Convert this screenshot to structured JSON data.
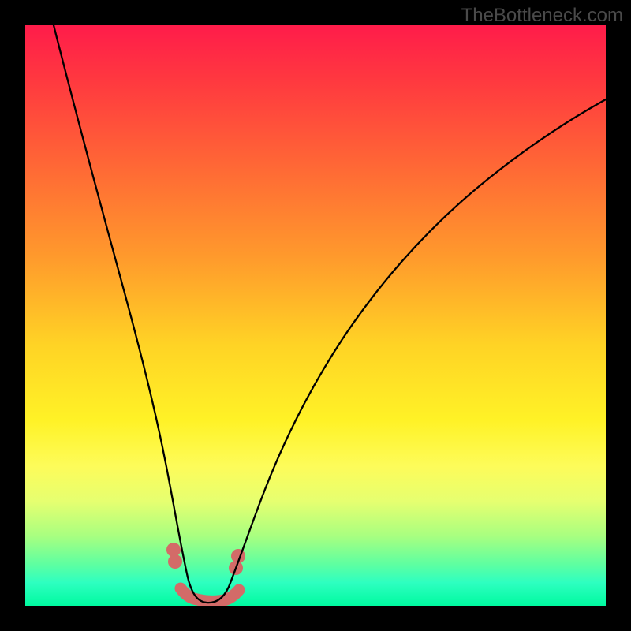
{
  "watermark": "TheBottleneck.com",
  "colors": {
    "frame": "#000000",
    "curve": "#000000",
    "valley_accent": "#d36b68",
    "gradient_top": "#ff1c4a",
    "gradient_bottom": "#00faa0"
  },
  "chart_data": {
    "type": "line",
    "title": "",
    "xlabel": "",
    "ylabel": "",
    "xlim": [
      0,
      100
    ],
    "ylim": [
      0,
      100
    ],
    "grid": false,
    "legend": false,
    "background": "vertical-gradient red→yellow→green",
    "series": [
      {
        "name": "bottleneck-curve",
        "note": "estimated from visual position; V-shaped curve with rounded valley near x≈31, y≈0",
        "x": [
          0,
          4,
          8,
          12,
          16,
          20,
          22,
          24,
          26,
          28,
          29,
          30,
          31,
          32,
          33,
          34,
          35,
          36,
          38,
          42,
          48,
          56,
          66,
          78,
          90,
          100
        ],
        "y": [
          100,
          84,
          68,
          53,
          38,
          25,
          19,
          14,
          9,
          5,
          3,
          1.5,
          1,
          1,
          1.5,
          2.5,
          4,
          6,
          10,
          19,
          31,
          45,
          58,
          70,
          78,
          84
        ]
      }
    ],
    "annotations": [
      {
        "name": "valley-highlight",
        "type": "thick-stroke",
        "color": "#d36b68",
        "x_range": [
          27,
          36
        ],
        "y_approx": 2
      },
      {
        "name": "shoulder-dots",
        "type": "points",
        "color": "#d36b68",
        "points": [
          {
            "x": 25.5,
            "y": 9.5
          },
          {
            "x": 25.8,
            "y": 7.5
          },
          {
            "x": 36.0,
            "y": 6.0
          },
          {
            "x": 36.5,
            "y": 8.0
          }
        ]
      }
    ]
  }
}
